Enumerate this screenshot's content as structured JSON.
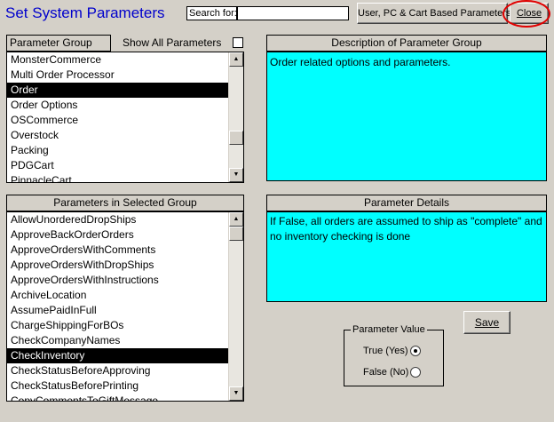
{
  "window": {
    "title": "Set System Parameters"
  },
  "toolbar": {
    "search_label": "Search for:",
    "search_value": "",
    "user_pc_cart_button": "User, PC & Cart Based Parameters",
    "close_button": "Close"
  },
  "parameter_group": {
    "header": "Parameter Group",
    "show_all_label": "Show All Parameters",
    "show_all_checked": false,
    "items": [
      {
        "label": "MonsterCommerce",
        "selected": false
      },
      {
        "label": "Multi Order Processor",
        "selected": false
      },
      {
        "label": "Order",
        "selected": true
      },
      {
        "label": "Order Options",
        "selected": false
      },
      {
        "label": "OSCommerce",
        "selected": false
      },
      {
        "label": "Overstock",
        "selected": false
      },
      {
        "label": "Packing",
        "selected": false
      },
      {
        "label": "PDGCart",
        "selected": false
      },
      {
        "label": "PinnacleCart",
        "selected": false
      }
    ]
  },
  "group_description": {
    "header": "Description of Parameter Group",
    "text": "Order related options and parameters."
  },
  "parameters": {
    "header": "Parameters in Selected Group",
    "items": [
      {
        "label": "AllowUnorderedDropShips",
        "selected": false
      },
      {
        "label": "ApproveBackOrderOrders",
        "selected": false
      },
      {
        "label": "ApproveOrdersWithComments",
        "selected": false
      },
      {
        "label": "ApproveOrdersWithDropShips",
        "selected": false
      },
      {
        "label": "ApproveOrdersWithInstructions",
        "selected": false
      },
      {
        "label": "ArchiveLocation",
        "selected": false
      },
      {
        "label": "AssumePaidInFull",
        "selected": false
      },
      {
        "label": "ChargeShippingForBOs",
        "selected": false
      },
      {
        "label": "CheckCompanyNames",
        "selected": false
      },
      {
        "label": "CheckInventory",
        "selected": true
      },
      {
        "label": "CheckStatusBeforeApproving",
        "selected": false
      },
      {
        "label": "CheckStatusBeforePrinting",
        "selected": false
      },
      {
        "label": "CopyCommentsToGiftMessage",
        "selected": false
      }
    ]
  },
  "parameter_details": {
    "header": "Parameter Details",
    "text": "If False, all orders are assumed to ship as \"complete\" and no inventory checking is done"
  },
  "save_button": "Save",
  "parameter_value": {
    "legend": "Parameter Value",
    "true_label": "True (Yes)",
    "false_label": "False (No)",
    "value": true
  },
  "colors": {
    "title": "#0000cc",
    "detail_background": "#00ffff",
    "selection": "#000000",
    "highlight_oval": "#e00000",
    "window_background": "#d4d0c8"
  }
}
